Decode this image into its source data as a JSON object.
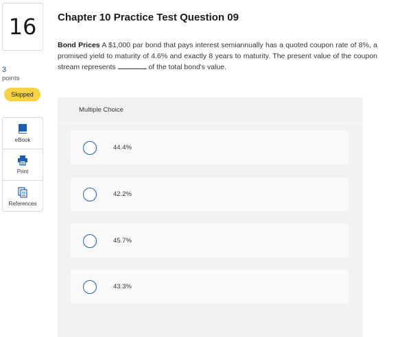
{
  "question": {
    "number": "16",
    "points_value": "3",
    "points_label": "points",
    "status": "Skipped",
    "title": "Chapter 10 Practice Test Question 09",
    "topic": "Bond Prices",
    "text_before_blank": "A $1,000 par bond that pays interest semiannually has a quoted coupon rate of 8%, a promised yield to maturity of 4.6% and exactly 8 years to maturity. The present value of the coupon stream represents",
    "text_after_blank": "of the total bond's value."
  },
  "tools": [
    {
      "label": "eBook",
      "icon": "book-icon"
    },
    {
      "label": "Print",
      "icon": "printer-icon"
    },
    {
      "label": "References",
      "icon": "documents-icon"
    }
  ],
  "multiple_choice": {
    "header": "Multiple Choice",
    "options": [
      "44.4%",
      "42.2%",
      "45.7%",
      "43.3%"
    ]
  },
  "colors": {
    "accent": "#1a5fb4",
    "badge": "#f6d245",
    "panel": "#f2f2f2"
  }
}
